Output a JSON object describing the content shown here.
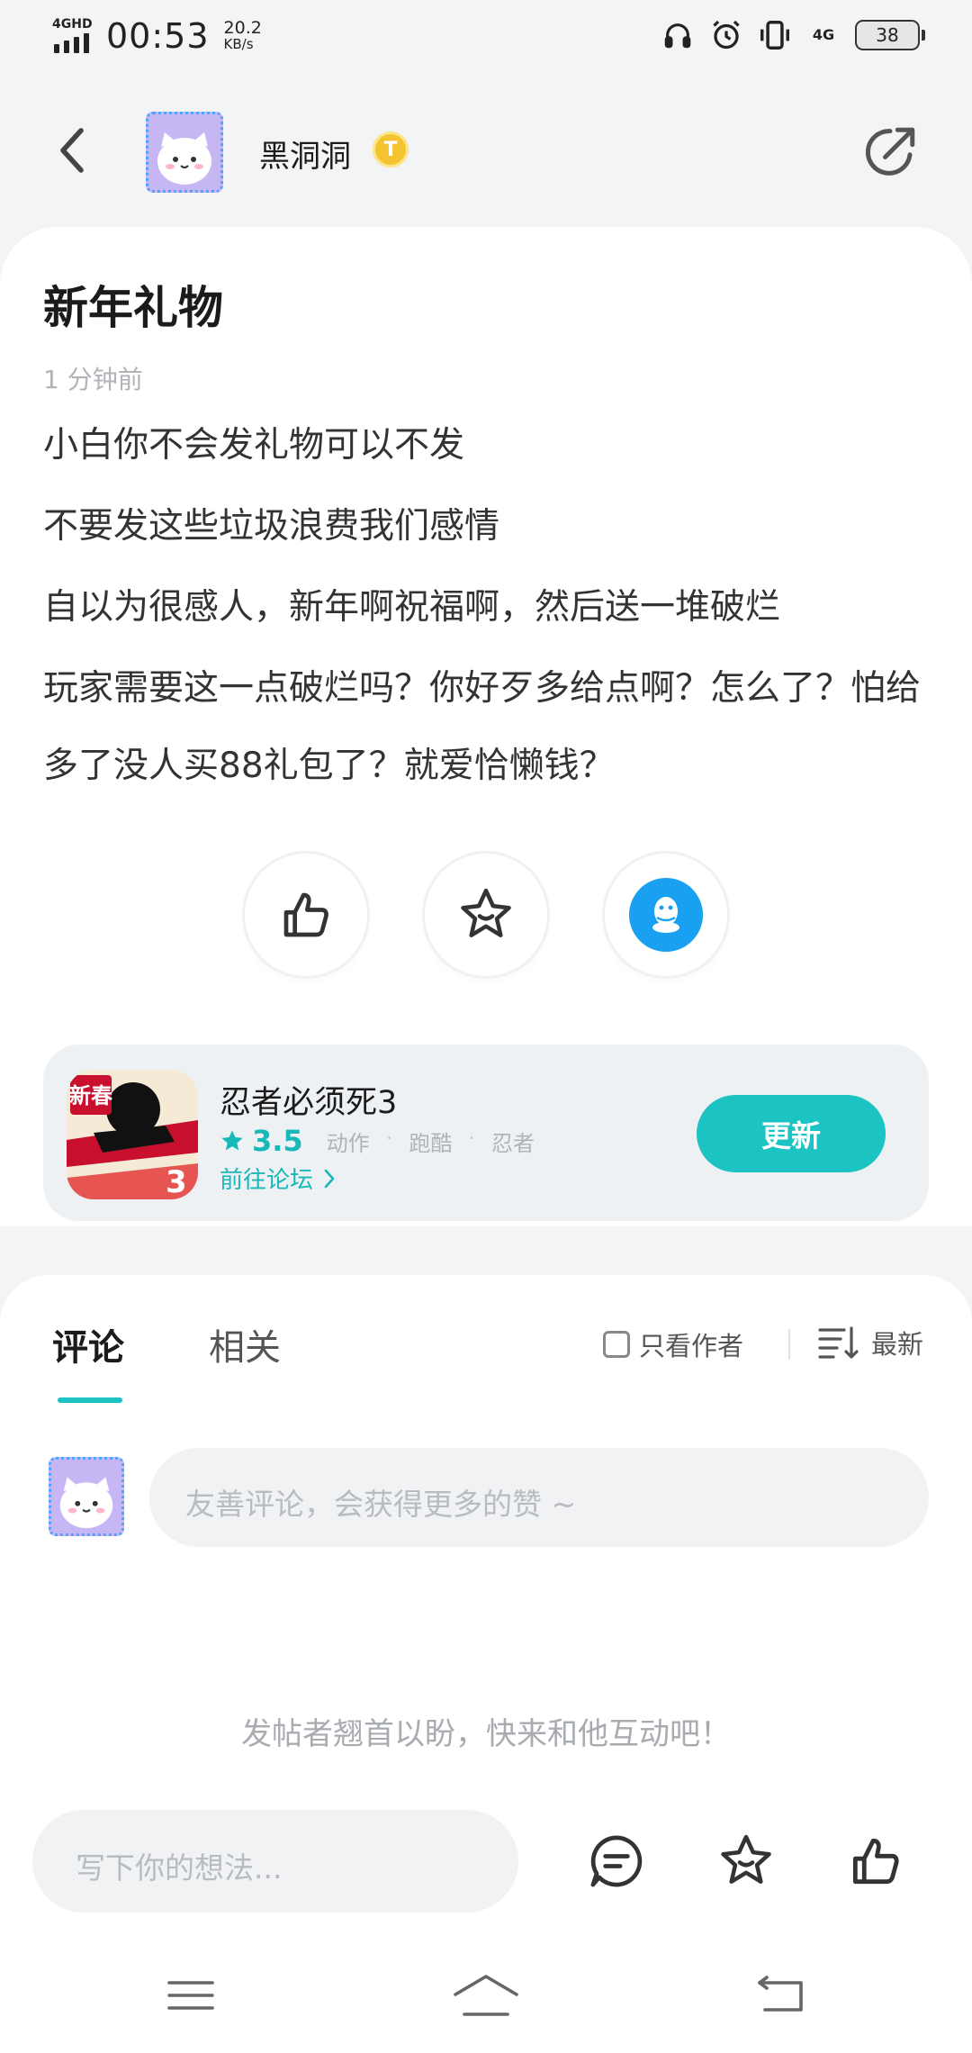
{
  "status_bar": {
    "network_label": "4GHD",
    "time": "00:53",
    "speed_value": "20.2",
    "speed_unit": "KB/s",
    "net_right_label": "4G",
    "battery": "38",
    "icons": [
      "headphones-icon",
      "alarm-icon",
      "vibrate-icon",
      "signal-4g-icon",
      "battery-icon"
    ]
  },
  "header": {
    "username": "黑洞洞",
    "level_badge": "T"
  },
  "post": {
    "title": "新年礼物",
    "time": "1 分钟前",
    "lines": [
      "小白你不会发礼物可以不发",
      "不要发这些垃圾浪费我们感情",
      "自以为很感人，新年啊祝福啊，然后送一堆破烂",
      "玩家需要这一点破烂吗？你好歹多给点啊？怎么了？怕给多了没人买88礼包了？就爱恰懒钱？"
    ]
  },
  "game": {
    "name": "忍者必须死3",
    "rating": "3.5",
    "tags": [
      "动作",
      "跑酷",
      "忍者"
    ],
    "forum_link": "前往论坛",
    "update_label": "更新",
    "icon_text_badge": "新春",
    "icon_number": "3"
  },
  "comments": {
    "tab_comments": "评论",
    "tab_related": "相关",
    "author_only": "只看作者",
    "sort_label": "最新",
    "input_placeholder": "友善评论，会获得更多的赞 ~",
    "empty_text": "发帖者翘首以盼，快来和他互动吧！"
  },
  "bottom": {
    "write_placeholder": "写下你的想法..."
  },
  "colors": {
    "accent": "#1cc3c3",
    "qq_blue": "#1aa0f0",
    "level_gold": "#f4c430"
  }
}
